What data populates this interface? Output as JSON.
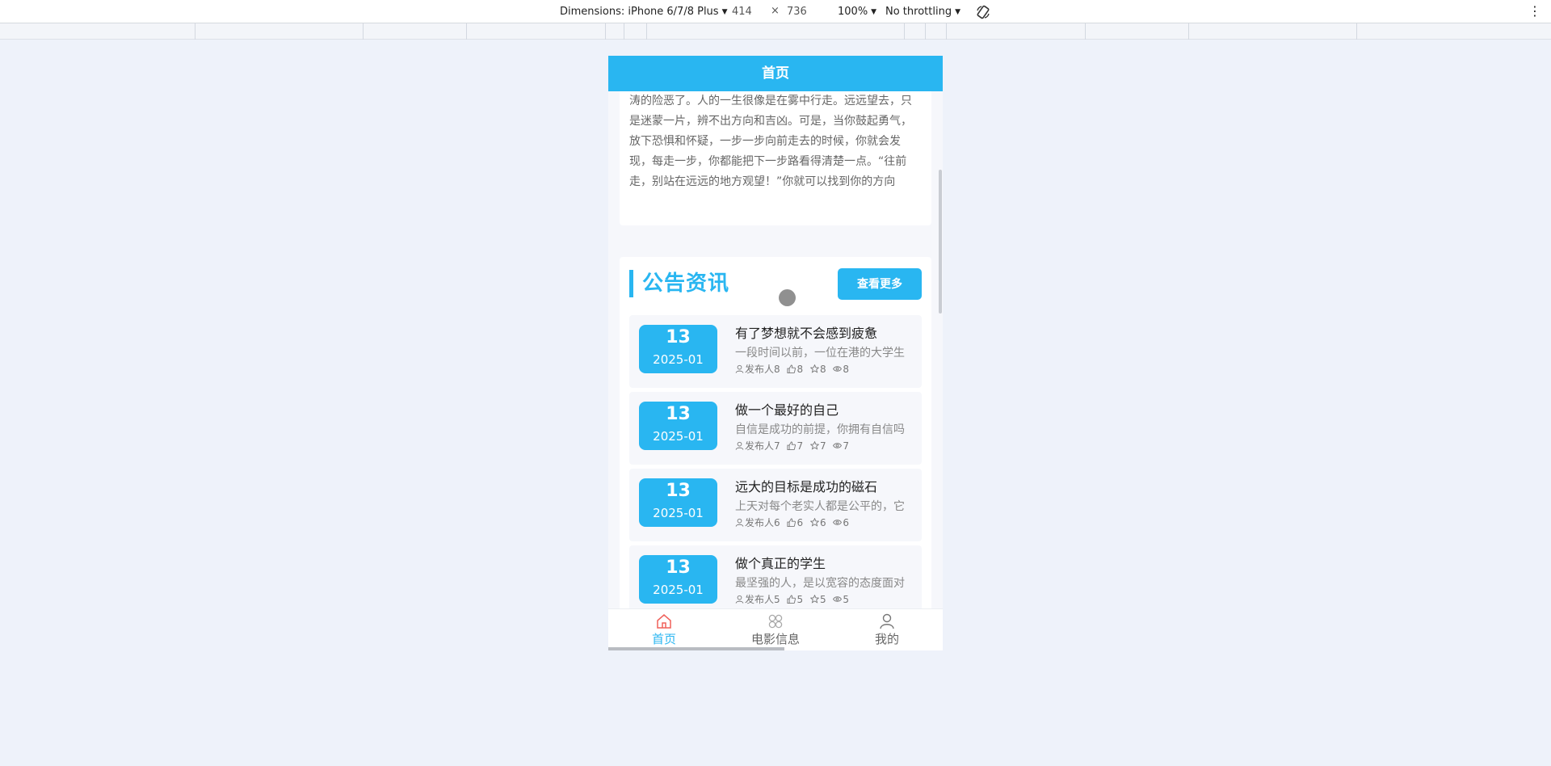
{
  "devtools": {
    "dimensions_label": "Dimensions: iPhone 6/7/8 Plus",
    "width": "414",
    "times": "×",
    "height": "736",
    "zoom": "100%",
    "throttling": "No throttling"
  },
  "header": {
    "title": "首页"
  },
  "story": {
    "text": "涛的险恶了。人的一生很像是在雾中行走。远远望去，只是迷蒙一片，辨不出方向和吉凶。可是，当你鼓起勇气，放下恐惧和怀疑，一步一步向前走去的时候，你就会发现，每走一步，你都能把下一步路看得清楚一点。“往前走，别站在远远的地方观望！”你就可以找到你的方向"
  },
  "notice": {
    "title": "公告资讯",
    "more_label": "查看更多",
    "items": [
      {
        "day": "13",
        "ym": "2025-01",
        "title": "有了梦想就不会感到疲惫",
        "desc": "一段时间以前，一位在港的大学生",
        "publisher": "发布人8",
        "likes": "8",
        "stars": "8",
        "views": "8"
      },
      {
        "day": "13",
        "ym": "2025-01",
        "title": "做一个最好的自己",
        "desc": "自信是成功的前提，你拥有自信吗",
        "publisher": "发布人7",
        "likes": "7",
        "stars": "7",
        "views": "7"
      },
      {
        "day": "13",
        "ym": "2025-01",
        "title": "远大的目标是成功的磁石",
        "desc": "上天对每个老实人都是公平的，它",
        "publisher": "发布人6",
        "likes": "6",
        "stars": "6",
        "views": "6"
      },
      {
        "day": "13",
        "ym": "2025-01",
        "title": "做个真正的学生",
        "desc": "最坚强的人，是以宽容的态度面对",
        "publisher": "发布人5",
        "likes": "5",
        "stars": "5",
        "views": "5"
      }
    ]
  },
  "tabbar": {
    "home": "首页",
    "movies": "电影信息",
    "mine": "我的"
  },
  "colors": {
    "accent": "#29b6f1",
    "home_icon": "#f0605a"
  }
}
